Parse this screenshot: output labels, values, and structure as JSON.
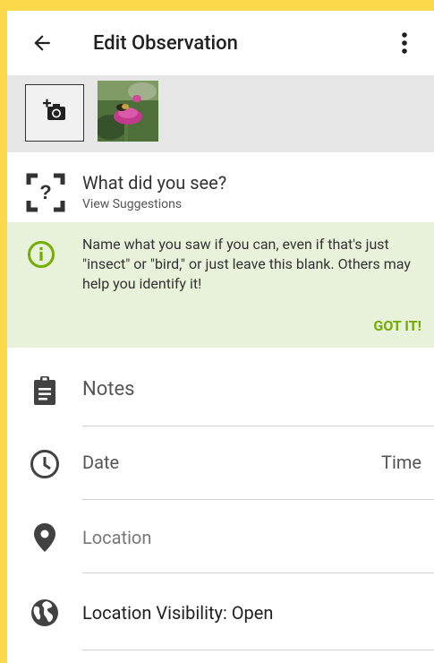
{
  "toolbar": {
    "title": "Edit Observation",
    "back_icon": "arrow-back-icon",
    "more_icon": "more-vert-icon"
  },
  "photos": {
    "add_icon": "add-photo-icon",
    "thumbnail": "bee-on-thistle-photo"
  },
  "identification": {
    "title": "What did you see?",
    "subtitle": "View Suggestions",
    "icon": "species-unknown-icon"
  },
  "tip": {
    "icon": "info-icon",
    "text": "Name what you saw if you can, even if that's just \"insect\" or \"bird,\" or just leave this blank. Others may help you identify it!",
    "action": "GOT IT!",
    "accent": "#74ac00",
    "background": "#e8f1da"
  },
  "fields": {
    "notes": {
      "placeholder": "Notes",
      "icon": "clipboard-icon"
    },
    "date": {
      "placeholder": "Date",
      "time_placeholder": "Time",
      "icon": "clock-icon"
    },
    "location": {
      "placeholder": "Location",
      "icon": "pin-icon"
    },
    "visibility": {
      "label": "Location Visibility: Open",
      "icon": "globe-icon"
    }
  },
  "colors": {
    "frame_background": "#fcd94a",
    "strip_background": "#e6e6e6"
  }
}
